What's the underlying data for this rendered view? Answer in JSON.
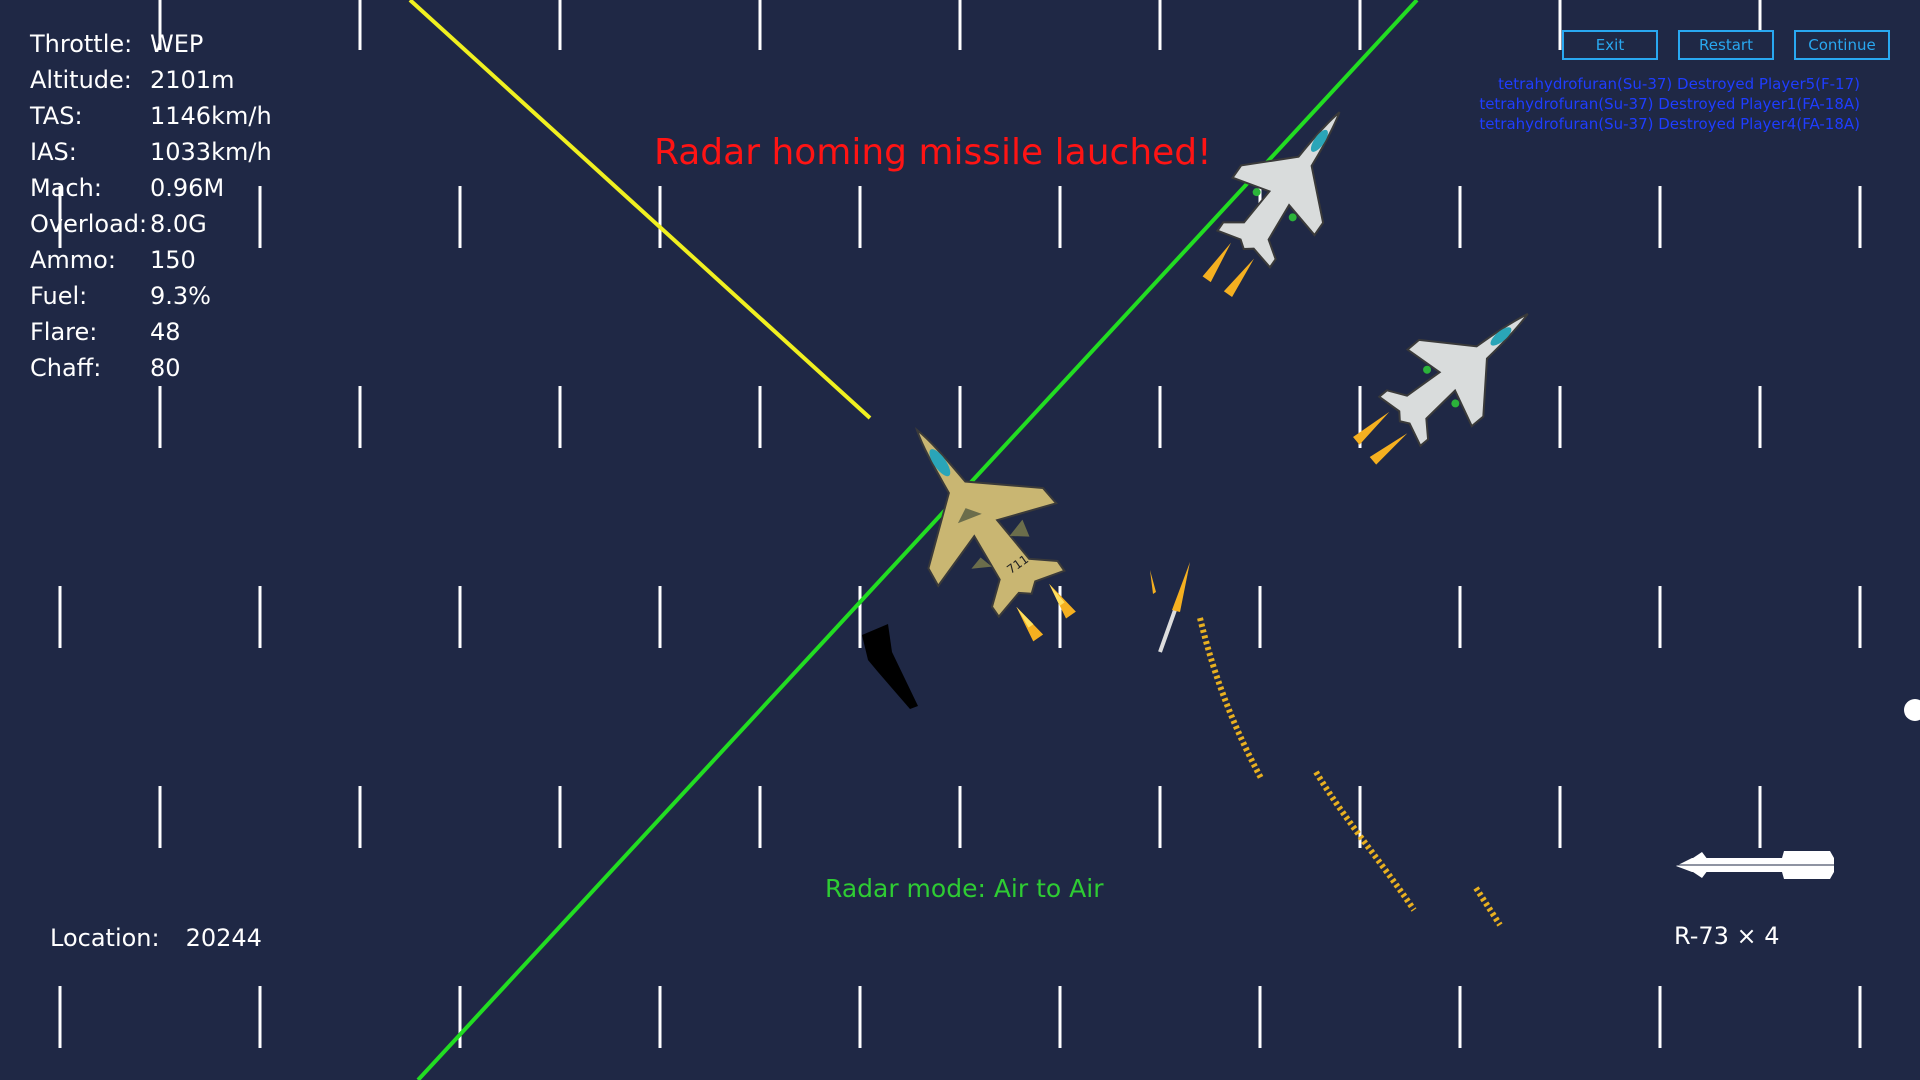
{
  "hud": {
    "stats": [
      {
        "label": "Throttle:",
        "value": "WEP"
      },
      {
        "label": "Altitude:",
        "value": "2101m"
      },
      {
        "label": "TAS:",
        "value": "1146km/h"
      },
      {
        "label": "IAS:",
        "value": "1033km/h"
      },
      {
        "label": "Mach:",
        "value": "0.96M"
      },
      {
        "label": "Overload:",
        "value": "8.0G"
      },
      {
        "label": "Ammo:",
        "value": "150"
      },
      {
        "label": "Fuel:",
        "value": "9.3%"
      },
      {
        "label": "Flare:",
        "value": "48"
      },
      {
        "label": "Chaff:",
        "value": "80"
      }
    ]
  },
  "buttons": {
    "exit": "Exit",
    "restart": "Restart",
    "continue": "Continue"
  },
  "kill_feed": [
    "tetrahydrofuran(Su-37) Destroyed Player5(F-17)",
    "tetrahydrofuran(Su-37) Destroyed Player1(FA-18A)",
    "tetrahydrofuran(Su-37) Destroyed Player4(FA-18A)"
  ],
  "alert": {
    "text": "Radar homing missile lauched!"
  },
  "radar": {
    "mode_text": "Radar mode: Air to Air"
  },
  "location": {
    "label": "Location:",
    "value": "20244"
  },
  "weapon": {
    "text": "R-73 × 4",
    "icon": "missile-icon"
  },
  "colors": {
    "background": "#1f2845",
    "button": "#29a8f0",
    "kill_feed": "#1f3dff",
    "alert": "#ff1414",
    "radar_mode": "#2ecc33",
    "green_line": "#22dd22",
    "yellow_line": "#f0f020"
  }
}
